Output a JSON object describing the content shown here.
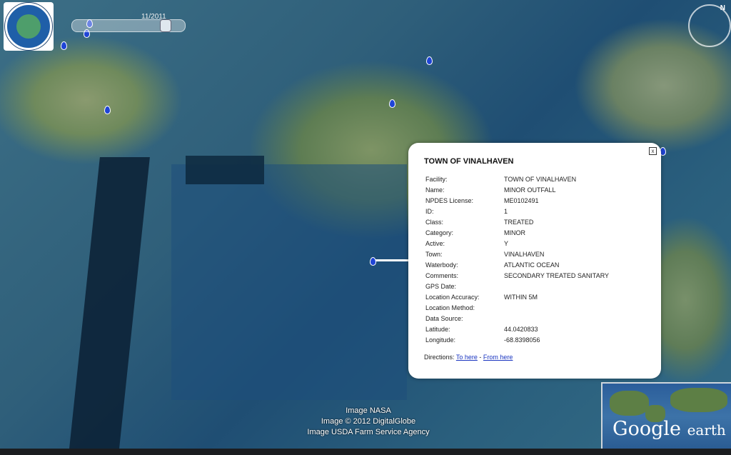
{
  "logo": {
    "name": "maine-dep-seal-icon",
    "text": "DEPARTMENT OF ENVIRONMENTAL PROTECTION STATE OF MAINE"
  },
  "timeline": {
    "label": "11/2011"
  },
  "compass": {
    "label": "N"
  },
  "balloon": {
    "title": "TOWN OF VINALHAVEN",
    "close": "x",
    "rows": [
      {
        "key": "Facility:",
        "value": "TOWN OF VINALHAVEN"
      },
      {
        "key": "Name:",
        "value": "MINOR OUTFALL"
      },
      {
        "key": "NPDES License:",
        "value": "ME0102491"
      },
      {
        "key": "ID:",
        "value": "1"
      },
      {
        "key": "Class:",
        "value": "TREATED"
      },
      {
        "key": "Category:",
        "value": "MINOR"
      },
      {
        "key": "Active:",
        "value": "Y"
      },
      {
        "key": "Town:",
        "value": "VINALHAVEN"
      },
      {
        "key": "Waterbody:",
        "value": "ATLANTIC OCEAN"
      },
      {
        "key": "Comments:",
        "value": "SECONDARY TREATED SANITARY"
      },
      {
        "key": "GPS Date:",
        "value": ""
      },
      {
        "key": "Location Accuracy:",
        "value": "WITHIN 5M"
      },
      {
        "key": "Location Method:",
        "value": ""
      },
      {
        "key": "Data Source:",
        "value": ""
      },
      {
        "key": "Latitude:",
        "value": "44.0420833"
      },
      {
        "key": "Longitude:",
        "value": "-68.8398056"
      }
    ],
    "directions_label": "Directions:",
    "to_here": "To here",
    "separator": "-",
    "from_here": "From here"
  },
  "credits": {
    "line1": "Image NASA",
    "line2": "Image © 2012 DigitalGlobe",
    "line3": "Image USDA Farm Service Agency"
  },
  "overview": {
    "brand": "Google",
    "brand2": "earth"
  },
  "colors": {
    "pin": "#1f44d6",
    "link": "#1a35c0"
  }
}
